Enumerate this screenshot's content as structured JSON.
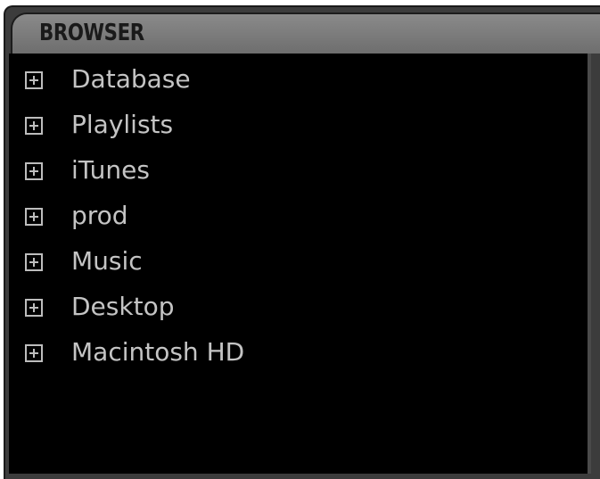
{
  "browser": {
    "title": "BROWSER",
    "items": [
      {
        "label": "Database",
        "icon": "plus-box-icon"
      },
      {
        "label": "Playlists",
        "icon": "plus-box-icon"
      },
      {
        "label": "iTunes",
        "icon": "plus-box-icon"
      },
      {
        "label": "prod",
        "icon": "plus-box-icon"
      },
      {
        "label": "Music",
        "icon": "plus-box-icon"
      },
      {
        "label": "Desktop",
        "icon": "plus-box-icon"
      },
      {
        "label": "Macintosh HD",
        "icon": "plus-box-icon"
      }
    ]
  },
  "colors": {
    "panel_bg": "#000000",
    "frame_bg": "#3c3c3c",
    "tab_bg": "#7c7c7c",
    "text": "#c4c4c4"
  }
}
